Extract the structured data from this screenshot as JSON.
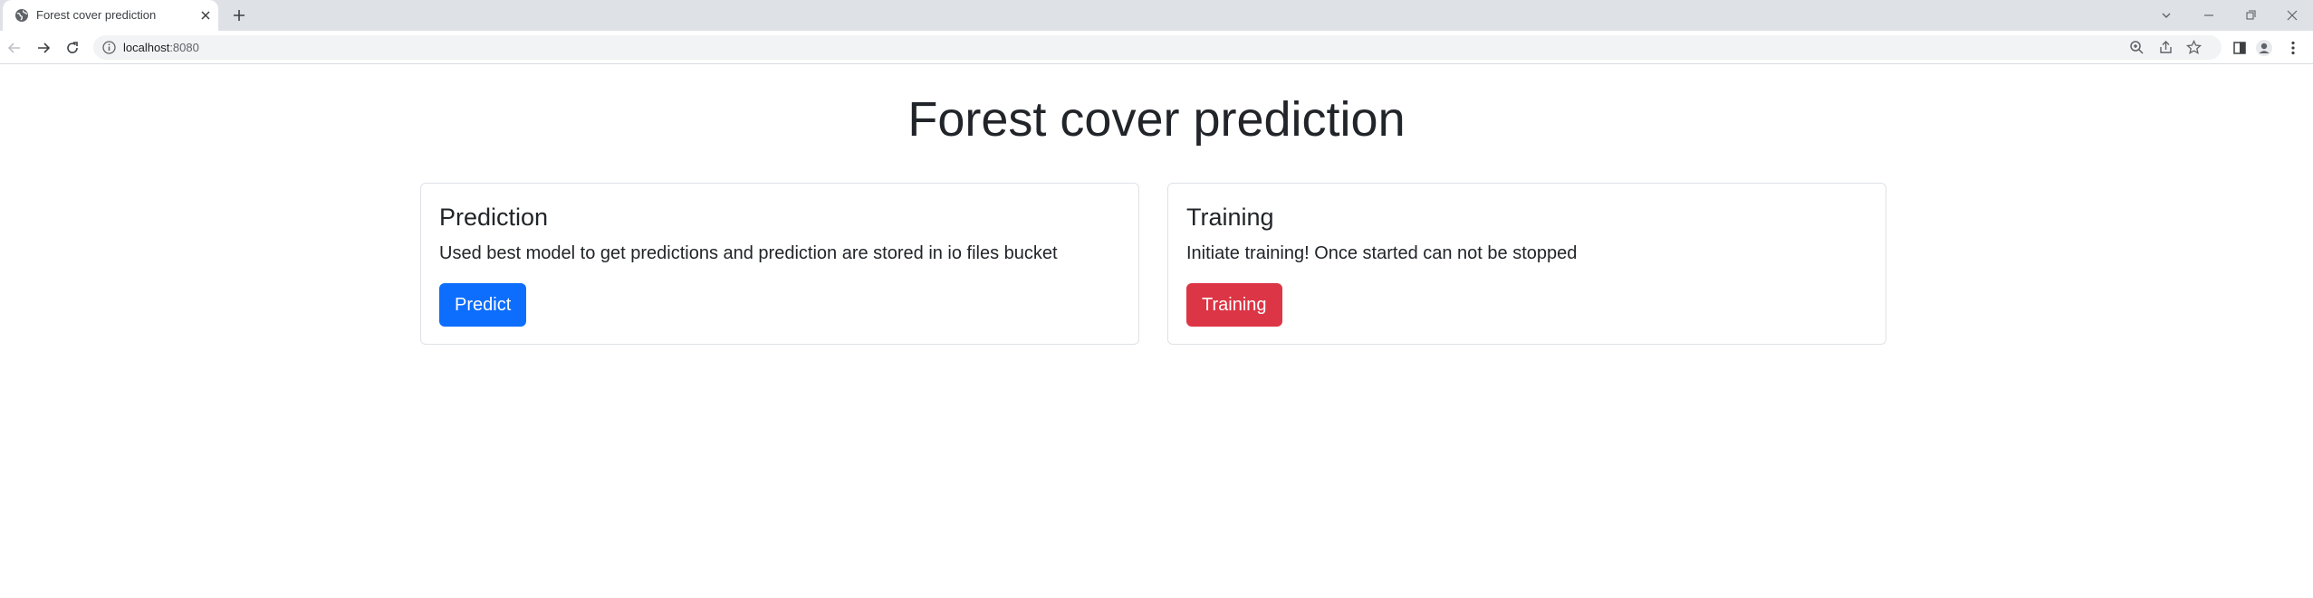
{
  "browser": {
    "tab_title": "Forest cover prediction",
    "url_host": "localhost",
    "url_port": ":8080"
  },
  "page": {
    "title": "Forest cover prediction"
  },
  "cards": [
    {
      "title": "Prediction",
      "text": "Used best model to get predictions and prediction are stored in io files bucket",
      "button_label": "Predict",
      "button_color": "#0d6efd"
    },
    {
      "title": "Training",
      "text": "Initiate training! Once started can not be stopped",
      "button_label": "Training",
      "button_color": "#dc3545"
    }
  ]
}
